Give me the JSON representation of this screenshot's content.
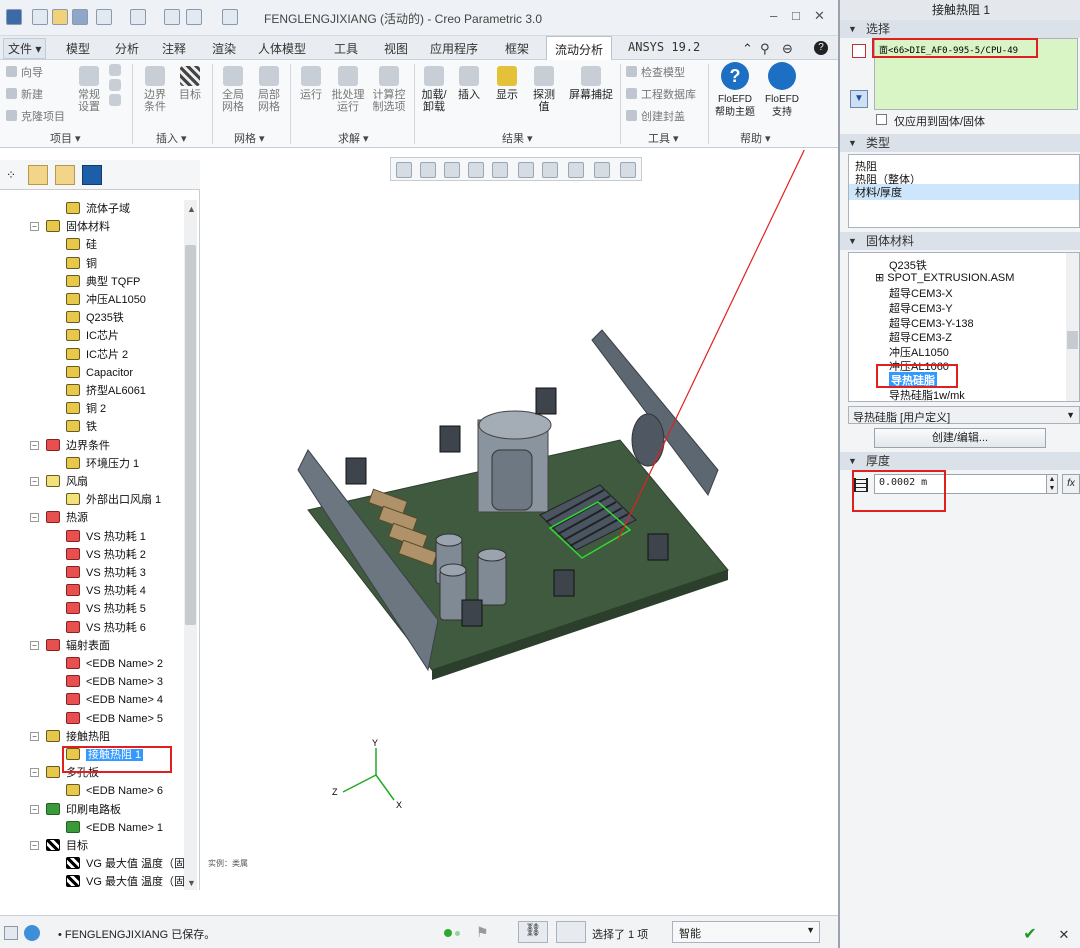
{
  "window": {
    "title": "FENGLENGJIXIANG (活动的) - Creo Parametric 3.0",
    "controls": [
      "–",
      "□",
      "✕"
    ]
  },
  "menu": {
    "file": "文件",
    "tabs": [
      "模型",
      "分析",
      "注释",
      "渲染",
      "人体模型",
      "工具",
      "视图",
      "应用程序",
      "框架",
      "流动分析",
      "ANSYS 19.2"
    ],
    "active_tab": "流动分析"
  },
  "ribbon": {
    "project_small": [
      "向导",
      "新建",
      "克隆项目"
    ],
    "buttons": {
      "general_settings": "常规\n设置",
      "boundary": "边界\n条件",
      "goal": "目标",
      "global_mesh": "全局\n网格",
      "local_mesh": "局部\n网格",
      "run": "运行",
      "batch_run": "批处理\n运行",
      "compute_control": "计算控\n制选项",
      "load_unload": "加载/\n卸载",
      "insert": "插入",
      "display": "显示",
      "probe": "探测值",
      "screen_capture": "屏幕捕捉",
      "help_topic": "FloEFD\n帮助主题",
      "support": "FloEFD\n支持"
    },
    "tools_small": [
      "检查模型",
      "工程数据库",
      "创建封盖"
    ],
    "groups": [
      "项目",
      "插入",
      "网格",
      "求解",
      "结果",
      "工具",
      "帮助"
    ]
  },
  "tree": {
    "items": [
      {
        "label": "流体子域",
        "level": 2,
        "icon": "fluid-icon"
      },
      {
        "label": "固体材料",
        "level": 1,
        "icon": "solid-material-icon",
        "exp": "−"
      },
      {
        "label": "硅",
        "level": 2,
        "icon": "material-icon"
      },
      {
        "label": "铜",
        "level": 2,
        "icon": "material-icon"
      },
      {
        "label": "典型 TQFP",
        "level": 2,
        "icon": "material-icon"
      },
      {
        "label": "冲压AL1050",
        "level": 2,
        "icon": "material-icon"
      },
      {
        "label": "Q235铁",
        "level": 2,
        "icon": "material-icon"
      },
      {
        "label": "IC芯片",
        "level": 2,
        "icon": "material-icon"
      },
      {
        "label": "IC芯片 2",
        "level": 2,
        "icon": "material-icon"
      },
      {
        "label": "Capacitor",
        "level": 2,
        "icon": "material-icon"
      },
      {
        "label": "挤型AL6061",
        "level": 2,
        "icon": "material-icon"
      },
      {
        "label": "铜 2",
        "level": 2,
        "icon": "material-icon"
      },
      {
        "label": "铁",
        "level": 2,
        "icon": "material-icon"
      },
      {
        "label": "边界条件",
        "level": 1,
        "icon": "boundary-icon",
        "exp": "−"
      },
      {
        "label": "环境压力 1",
        "level": 2,
        "icon": "pressure-icon"
      },
      {
        "label": "风扇",
        "level": 1,
        "icon": "fan-icon",
        "exp": "−"
      },
      {
        "label": "外部出口风扇 1",
        "level": 2,
        "icon": "fan-icon"
      },
      {
        "label": "热源",
        "level": 1,
        "icon": "heat-source-icon",
        "exp": "−"
      },
      {
        "label": "VS 热功耗 1",
        "level": 2,
        "icon": "heat-source-icon"
      },
      {
        "label": "VS 热功耗 2",
        "level": 2,
        "icon": "heat-source-icon"
      },
      {
        "label": "VS 热功耗 3",
        "level": 2,
        "icon": "heat-source-icon"
      },
      {
        "label": "VS 热功耗 4",
        "level": 2,
        "icon": "heat-source-icon"
      },
      {
        "label": "VS 热功耗 5",
        "level": 2,
        "icon": "heat-source-icon"
      },
      {
        "label": "VS 热功耗 6",
        "level": 2,
        "icon": "heat-source-icon"
      },
      {
        "label": "辐射表面",
        "level": 1,
        "icon": "radiation-icon",
        "exp": "−"
      },
      {
        "label": "<EDB Name> 2",
        "level": 2,
        "icon": "radiation-icon"
      },
      {
        "label": "<EDB Name> 3",
        "level": 2,
        "icon": "radiation-icon"
      },
      {
        "label": "<EDB Name> 4",
        "level": 2,
        "icon": "radiation-icon"
      },
      {
        "label": "<EDB Name> 5",
        "level": 2,
        "icon": "radiation-icon"
      },
      {
        "label": "接触热阻",
        "level": 1,
        "icon": "contact-resistance-icon",
        "exp": "−"
      },
      {
        "label": "接触热阻 1",
        "level": 2,
        "icon": "contact-resistance-icon",
        "selected": true
      },
      {
        "label": "多孔板",
        "level": 1,
        "icon": "perforated-plate-icon",
        "exp": "−"
      },
      {
        "label": "<EDB Name> 6",
        "level": 2,
        "icon": "perforated-plate-icon"
      },
      {
        "label": "印刷电路板",
        "level": 1,
        "icon": "pcb-icon",
        "exp": "−"
      },
      {
        "label": "<EDB Name> 1",
        "level": 2,
        "icon": "pcb-icon"
      },
      {
        "label": "目标",
        "level": 1,
        "icon": "goal-icon",
        "exp": "−"
      },
      {
        "label": "VG 最大值 温度（固",
        "level": 2,
        "icon": "goal-icon"
      },
      {
        "label": "VG 最大值 温度（固",
        "level": 2,
        "icon": "goal-icon"
      }
    ]
  },
  "viewport": {
    "instance_label": "实例：类属",
    "axes": [
      "Y",
      "Z",
      "X"
    ]
  },
  "status": {
    "message": "FENGLENGJIXIANG 已保存。",
    "selection": "选择了 1 项",
    "filter": "智能"
  },
  "panel": {
    "title": "接触热阻 1",
    "selection_header": "选择",
    "selected_face": "面<66>DIE_AF0-995-5/CPU-49",
    "apply_to_solids": "仅应用到固体/固体",
    "type_header": "类型",
    "types": [
      "热阻",
      "热阻（整体）",
      "材料/厚度"
    ],
    "selected_type_index": 2,
    "material_header": "固体材料",
    "materials": [
      "Q235铁",
      "SPOT_EXTRUSION.ASM",
      "超导CEM3-X",
      "超导CEM3-Y",
      "超导CEM3-Y-138",
      "超导CEM3-Z",
      "冲压AL1050",
      "冲压AL1060",
      "导热硅脂",
      "导热硅脂1w/mk"
    ],
    "selected_material_index": 8,
    "material_value": "导热硅脂 [用户定义]",
    "create_edit": "创建/编辑...",
    "thickness_header": "厚度",
    "thickness_value": "0.0002 m",
    "fx": "fx",
    "ok": "✔",
    "cancel": "✕"
  },
  "colors": {
    "accent": "#0078d7",
    "select": "#3399ff",
    "highlight_box": "#e02020",
    "selection_field_bg": "#d9f5c6"
  }
}
